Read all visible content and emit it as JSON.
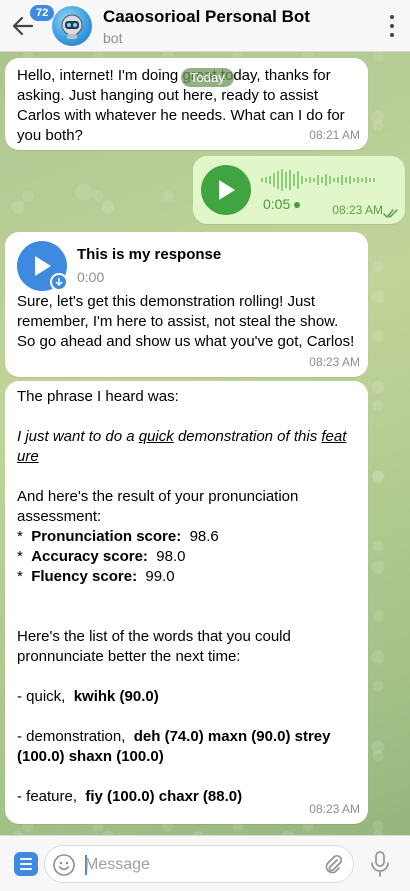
{
  "header": {
    "back_badge": "72",
    "title": "Caaosorioal Personal Bot",
    "subtitle": "bot"
  },
  "date_pill": "Today",
  "messages": {
    "m1": {
      "text": "Hello, internet! I'm doing great today, thanks for asking. Just hanging out here, ready to assist Carlos with whatever he needs. What can I do for you both?",
      "time": "08:21 AM"
    },
    "m2": {
      "duration": "0:05",
      "time": "08:23 AM"
    },
    "m3": {
      "voice_title": "This is my response",
      "voice_duration": "0:00",
      "text": "Sure, let's get this demonstration rolling! Just remember, I'm here to assist, not steal the show. So go ahead and show us what you've got, Carlos!",
      "time": "08:23 AM"
    },
    "m4": {
      "intro": "The phrase I heard was:",
      "phrase_part1": "I just want to do a ",
      "phrase_quick": "quick",
      "phrase_part2": " demonstration of this ",
      "phrase_feat": "feat",
      "phrase_ure": "ure",
      "result_intro": "And here's the result of your pronunciation assessment:",
      "scores": [
        {
          "bullet": "*",
          "label": "Pronunciation score:",
          "value": "98.6"
        },
        {
          "bullet": "*",
          "label": "Accuracy score:",
          "value": "98.0"
        },
        {
          "bullet": "*",
          "label": "Fluency score:",
          "value": "99.0"
        }
      ],
      "words_intro": "Here's the list of the words that you could pronnunciate better the next time:",
      "words": [
        {
          "prefix": "- quick,",
          "detail": "kwihk (90.0)"
        },
        {
          "prefix": "- demonstration,",
          "detail": "deh (74.0) maxn (90.0) strey (100.0) shaxn (100.0)"
        },
        {
          "prefix": "- feature,",
          "detail": "fiy (100.0) chaxr (88.0)"
        }
      ],
      "time": "08:23 AM"
    }
  },
  "input": {
    "placeholder": "Message"
  },
  "icons": [
    "back-arrow-icon",
    "bot-avatar",
    "more-vertical-icon",
    "play-icon",
    "download-icon",
    "double-check-icon",
    "menu-icon",
    "emoji-icon",
    "paperclip-icon",
    "microphone-icon"
  ],
  "colors": {
    "accent": "#3d8ae0",
    "voice_green": "#41a443",
    "outgoing_bubble": "#e1f7c9"
  }
}
